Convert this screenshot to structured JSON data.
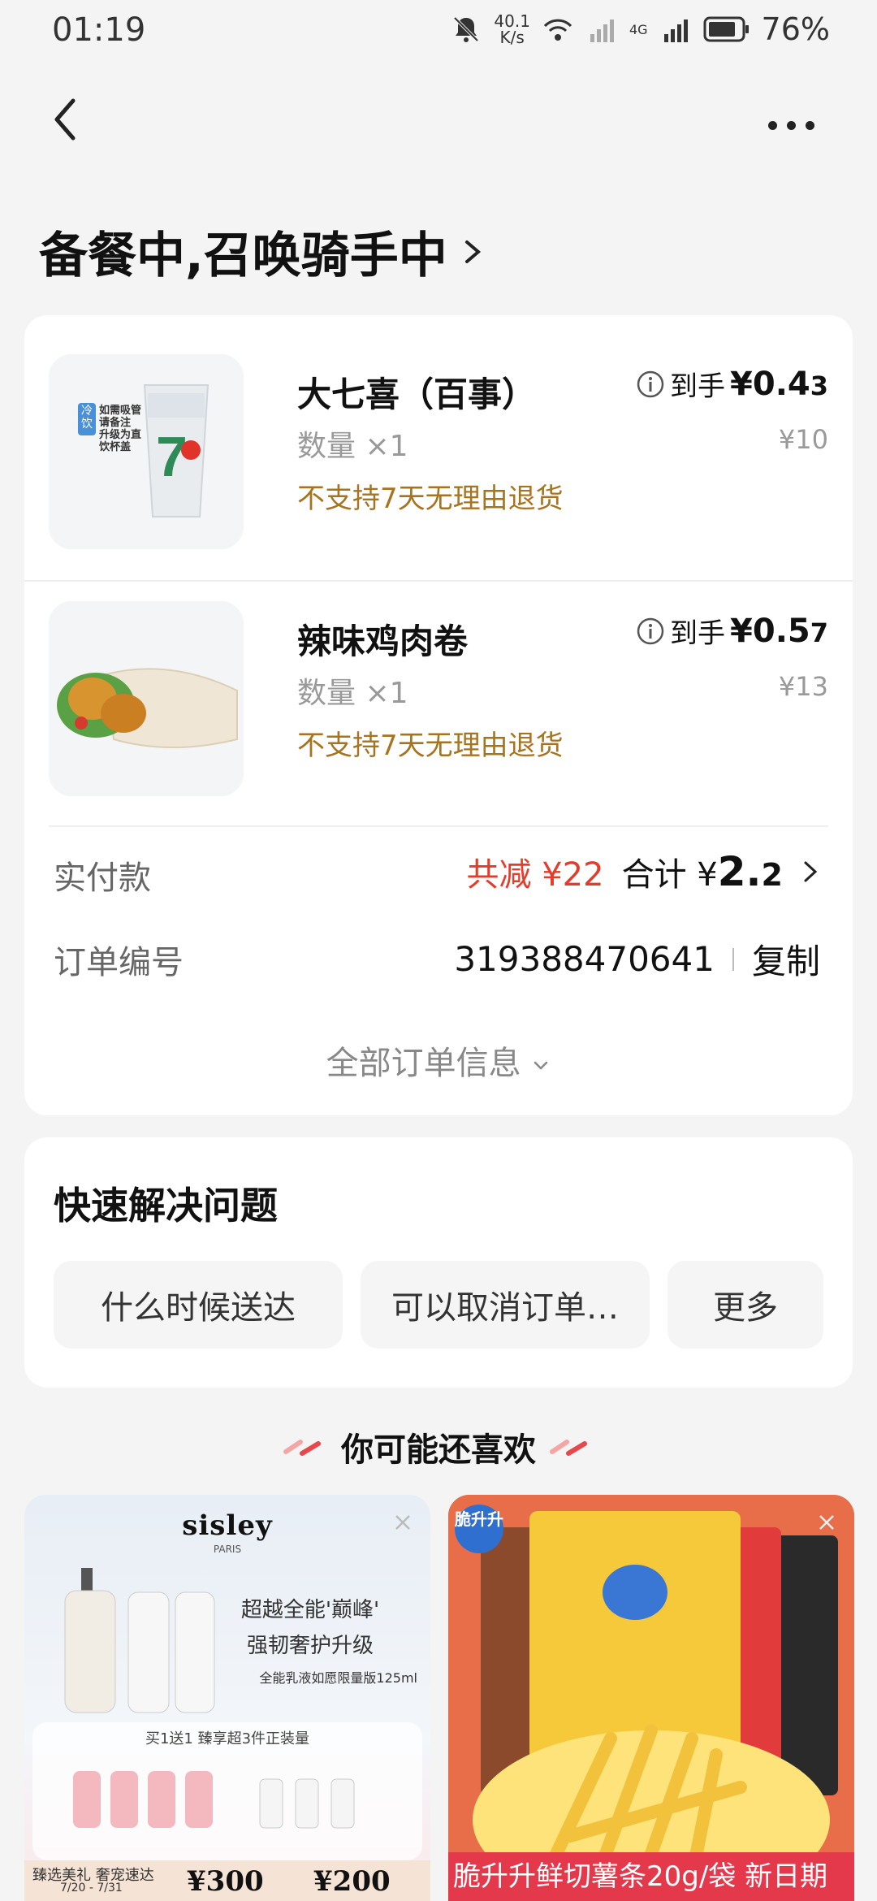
{
  "status_bar": {
    "time": "01:19",
    "speed_value": "40.1",
    "speed_unit": "K/s",
    "network": "4G",
    "battery": "76%"
  },
  "header": {
    "order_status": "备餐中,召唤骑手中"
  },
  "items": [
    {
      "name": "大七喜（百事）",
      "qty": "数量 ×1",
      "note": "不支持7天无理由退货",
      "price_label": "到手",
      "price_main": "¥0.4",
      "price_small": "3",
      "orig_price": "¥10",
      "thumb_tag": "冷饮",
      "thumb_text": "如需吸管请备注 升级为直饮杯盖"
    },
    {
      "name": "辣味鸡肉卷",
      "qty": "数量 ×1",
      "note": "不支持7天无理由退货",
      "price_label": "到手",
      "price_main": "¥0.5",
      "price_small": "7",
      "orig_price": "¥13"
    }
  ],
  "payment": {
    "label": "实付款",
    "discount": "共减 ¥22",
    "total_label": "合计 ¥",
    "total_big": "2.",
    "total_small": "2"
  },
  "order_no": {
    "label": "订单编号",
    "value": "319388470641",
    "copy": "复制"
  },
  "all_info": "全部订单信息",
  "quick": {
    "title": "快速解决问题",
    "chips": [
      "什么时候送达",
      "可以取消订单…",
      "更多"
    ]
  },
  "reco": {
    "title": "你可能还喜欢"
  },
  "ad_left": {
    "brand": "sisley",
    "brand_sub": "PARIS",
    "headline_1": "超越全能'巅峰'",
    "headline_2": "强韧奢护升级",
    "sub": "全能乳液如愿限量版125ml",
    "offer_title": "买1送1 臻享超3件正装量",
    "bottom_title": "臻选美礼 奢宠速达",
    "bottom_date": "7/20 - 7/31",
    "price_1": "¥300",
    "price_2": "¥200"
  },
  "ad_right": {
    "logo": "脆升升",
    "caption": "脆升升鲜切薯条20g/袋 新日期"
  },
  "colors": {
    "accent_red": "#e53b2a",
    "note_brown": "#a8731e"
  }
}
